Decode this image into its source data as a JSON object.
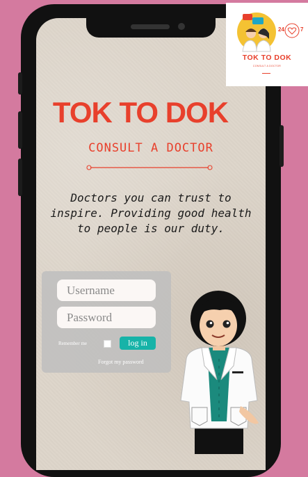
{
  "brand": {
    "name": "TOK TO DOK",
    "subtitle": "CONSULT A DOCTOR",
    "accent_color": "#e8402c"
  },
  "tagline": [
    "Doctors you can trust to",
    "inspire. Providing good health",
    "to people is our duty."
  ],
  "login": {
    "username_placeholder": "Username",
    "password_placeholder": "Password",
    "remember_label": "Remember me",
    "login_button": "log in",
    "forgot_password": "Forgot my password",
    "button_color": "#17b3a8"
  },
  "logo_card": {
    "name": "TOK TO DOK",
    "subtitle": "CONSULT A DOCTOR",
    "badge_left": "24",
    "badge_right": "7"
  },
  "icons": [
    "doctor-illustration",
    "logo-doctors-icon",
    "heart-badge-icon",
    "chat-bubbles-icon"
  ]
}
